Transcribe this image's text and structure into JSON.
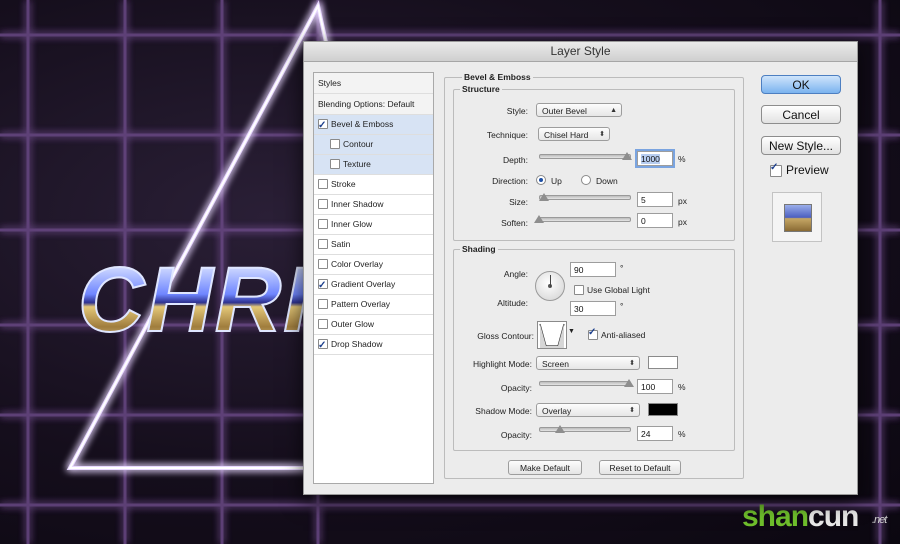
{
  "artwork": {
    "headline": "CHRIS"
  },
  "watermark": {
    "shan": "shan",
    "cun": "cun",
    "net": ".net"
  },
  "dialog": {
    "title": "Layer Style",
    "styles_header": "Styles",
    "blending": "Blending Options: Default",
    "effects": [
      {
        "label": "Bevel & Emboss",
        "checked": true
      },
      {
        "label": "Contour",
        "checked": false
      },
      {
        "label": "Texture",
        "checked": false
      },
      {
        "label": "Stroke",
        "checked": false
      },
      {
        "label": "Inner Shadow",
        "checked": false
      },
      {
        "label": "Inner Glow",
        "checked": false
      },
      {
        "label": "Satin",
        "checked": false
      },
      {
        "label": "Color Overlay",
        "checked": false
      },
      {
        "label": "Gradient Overlay",
        "checked": true
      },
      {
        "label": "Pattern Overlay",
        "checked": false
      },
      {
        "label": "Outer Glow",
        "checked": false
      },
      {
        "label": "Drop Shadow",
        "checked": true
      }
    ],
    "bevel": {
      "section_title": "Bevel & Emboss",
      "structure_title": "Structure",
      "style_label": "Style:",
      "style_value": "Outer Bevel",
      "technique_label": "Technique:",
      "technique_value": "Chisel Hard",
      "depth_label": "Depth:",
      "depth_value": "1000",
      "depth_unit": "%",
      "direction_label": "Direction:",
      "direction_up": "Up",
      "direction_down": "Down",
      "direction_selected": "Up",
      "size_label": "Size:",
      "size_value": "5",
      "size_unit": "px",
      "soften_label": "Soften:",
      "soften_value": "0",
      "soften_unit": "px"
    },
    "shading": {
      "title": "Shading",
      "angle_label": "Angle:",
      "angle_value": "90",
      "angle_unit": "°",
      "global_light_label": "Use Global Light",
      "global_light_checked": false,
      "altitude_label": "Altitude:",
      "altitude_value": "30",
      "altitude_unit": "°",
      "gloss_label": "Gloss Contour:",
      "anti_aliased_label": "Anti-aliased",
      "anti_aliased_checked": true,
      "highlight_label": "Highlight Mode:",
      "highlight_value": "Screen",
      "highlight_color": "#ffffff",
      "highlight_opacity_label": "Opacity:",
      "highlight_opacity": "100",
      "shadow_label": "Shadow Mode:",
      "shadow_value": "Overlay",
      "shadow_color": "#000000",
      "shadow_opacity_label": "Opacity:",
      "shadow_opacity": "24",
      "percent": "%"
    },
    "make_default": "Make Default",
    "reset_default": "Reset to Default",
    "ok": "OK",
    "cancel": "Cancel",
    "new_style": "New Style...",
    "preview_label": "Preview",
    "preview_checked": true
  }
}
